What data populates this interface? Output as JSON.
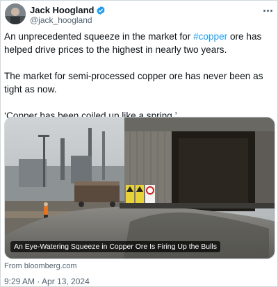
{
  "author": {
    "name": "Jack Hoogland",
    "handle": "@jack_hoogland",
    "verified_color": "#1d9bf0"
  },
  "tweet": {
    "line1_pre": "An unprecedented squeeze in the market for ",
    "hashtag": "#copper",
    "line1_post": " ore has helped drive prices to the highest in nearly two years.",
    "paragraph2": "The market for semi-processed copper ore has never been as tight as now.",
    "paragraph3": "‘Copper has been coiled up like a spring.’"
  },
  "card": {
    "caption": "An Eye-Watering Squeeze in Copper Ore Is Firing Up the Bulls",
    "source": "From bloomberg.com"
  },
  "timestamp": "9:29 AM · Apr 13, 2024",
  "colors": {
    "link": "#1d9bf0",
    "secondary_text": "#536471",
    "border": "#cfd9de"
  }
}
